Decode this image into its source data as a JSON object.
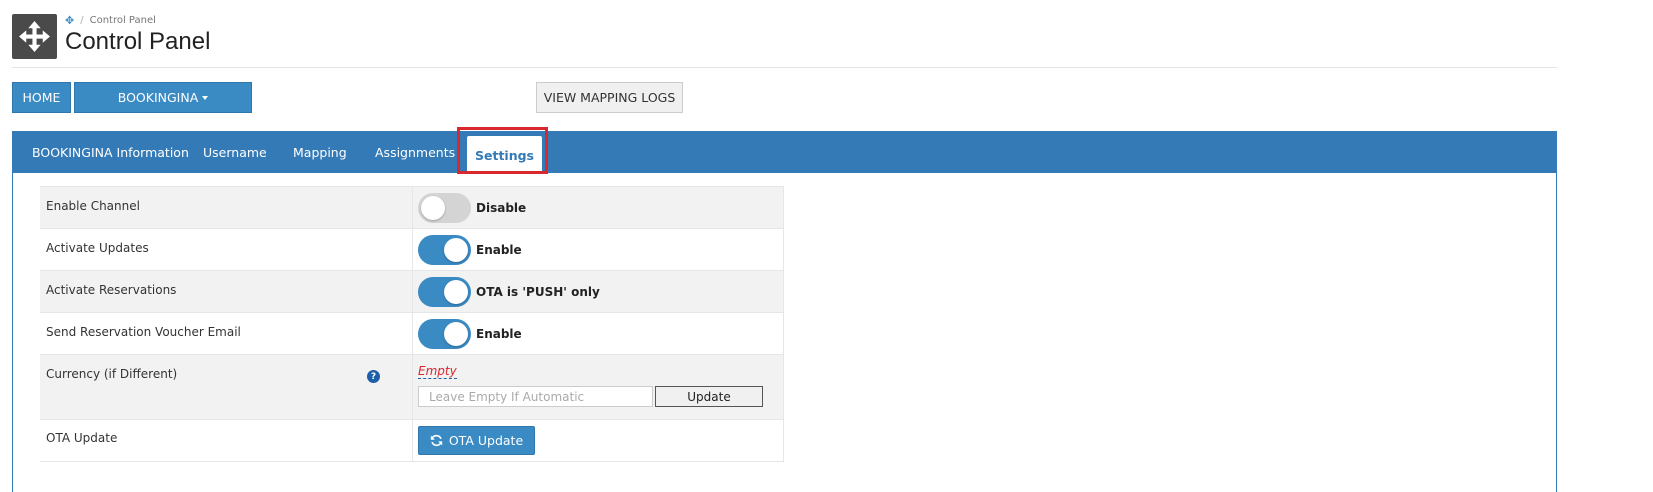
{
  "header": {
    "breadcrumb": "Control Panel",
    "title": "Control Panel",
    "logo_icon": "move-arrows-icon"
  },
  "actions": {
    "home_label": "HOME",
    "channel_label": "BOOKINGINA",
    "mapping_logs_label": "VIEW MAPPING LOGS"
  },
  "tabs": [
    {
      "label": "BOOKINGINA Information",
      "active": false
    },
    {
      "label": "Username",
      "active": false
    },
    {
      "label": "Mapping",
      "active": false
    },
    {
      "label": "Assignments",
      "active": false
    },
    {
      "label": "Settings",
      "active": true
    }
  ],
  "settings": {
    "enable_channel": {
      "label": "Enable Channel",
      "state": false,
      "state_label": "Disable"
    },
    "activate_updates": {
      "label": "Activate Updates",
      "state": true,
      "state_label": "Enable"
    },
    "activate_reservations": {
      "label": "Activate Reservations",
      "state": true,
      "state_label": "OTA is 'PUSH' only"
    },
    "send_voucher": {
      "label": "Send Reservation Voucher Email",
      "state": true,
      "state_label": "Enable"
    },
    "currency": {
      "label": "Currency (if Different)",
      "current_value": "Empty",
      "placeholder": "Leave Empty If Automatic",
      "update_label": "Update"
    },
    "ota_update": {
      "label": "OTA Update",
      "button_label": "OTA Update"
    }
  },
  "colors": {
    "primary": "#337ab7",
    "button_blue": "#3a8ac4",
    "highlight": "#d9272e"
  }
}
